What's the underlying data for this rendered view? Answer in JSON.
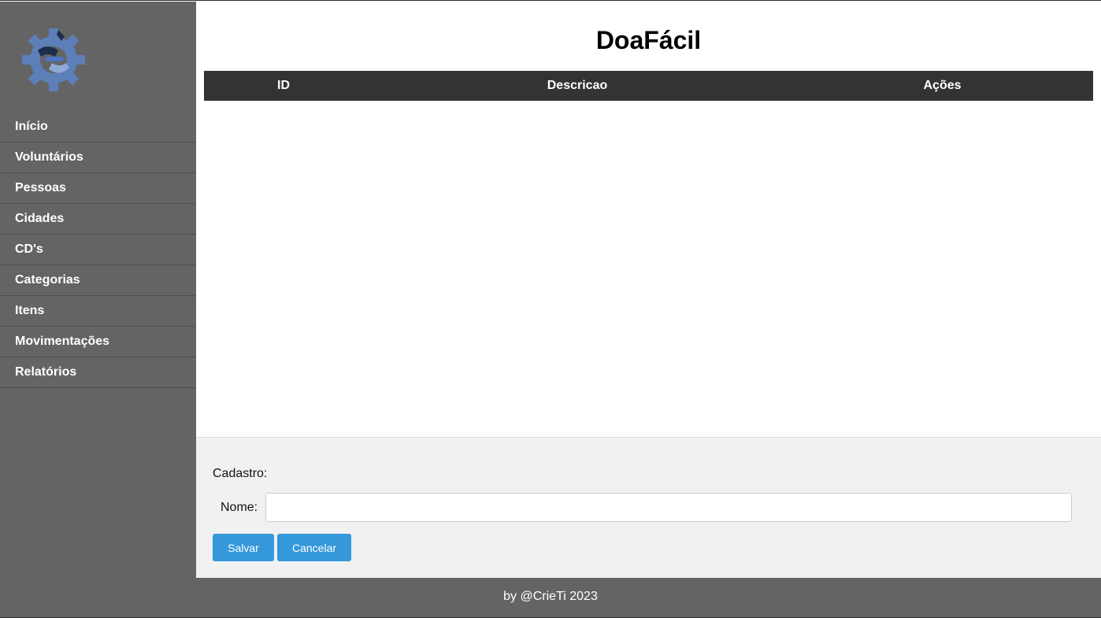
{
  "app": {
    "title": "DoaFácil"
  },
  "sidebar": {
    "logo_icon": "gear-hands-logo",
    "items": [
      {
        "label": "Início"
      },
      {
        "label": "Voluntários"
      },
      {
        "label": "Pessoas"
      },
      {
        "label": "Cidades"
      },
      {
        "label": "CD's"
      },
      {
        "label": "Categorias"
      },
      {
        "label": "Itens"
      },
      {
        "label": "Movimentações"
      },
      {
        "label": "Relatórios"
      }
    ]
  },
  "table": {
    "columns": [
      "ID",
      "Descricao",
      "Ações"
    ],
    "rows": []
  },
  "form": {
    "title": "Cadastro:",
    "nome_label": "Nome:",
    "nome_value": "",
    "save_label": "Salvar",
    "cancel_label": "Cancelar"
  },
  "footer": {
    "text": "by @CrieTi 2023"
  },
  "colors": {
    "sidebar_bg": "#646464",
    "table_header_bg": "#333333",
    "button_bg": "#3498db",
    "form_bg": "#f1f1f1"
  }
}
